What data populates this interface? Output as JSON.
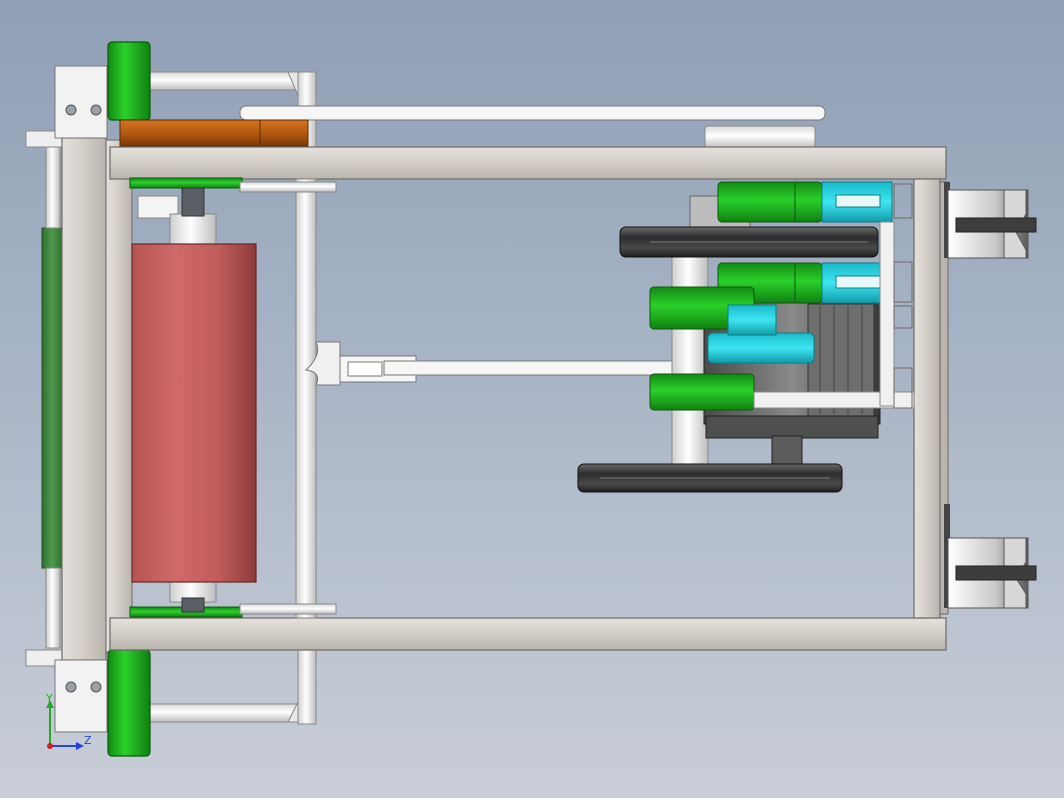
{
  "viewport": {
    "background_top": "#8f9fb5",
    "background_bottom": "#c9ced8"
  },
  "triad": {
    "y_label": "Y",
    "z_label": "Z",
    "y_color": "#22aa22",
    "z_color": "#2244dd",
    "origin_color": "#cc2222"
  },
  "colors": {
    "frame_beam": "#d3cfc8",
    "frame_edge": "#6e6a64",
    "bearing_green": "#1ea81e",
    "roller_red": "#c86060",
    "pulley_dark": "#3a3a3a",
    "bracket_cyan": "#22d8e8",
    "link_white": "#f2f2f2",
    "orange_bar": "#b35a10",
    "belt_green": "#3e8a3e"
  }
}
